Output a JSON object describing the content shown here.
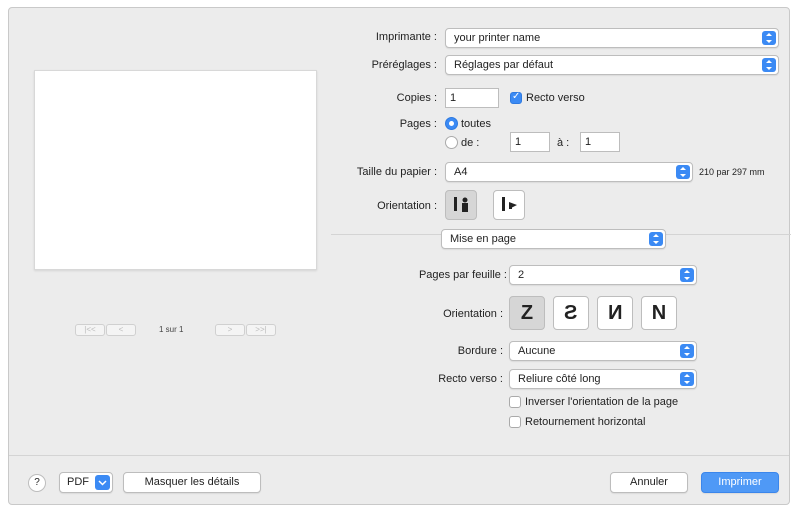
{
  "printer": {
    "label": "Imprimante :",
    "value": "your printer name"
  },
  "presets": {
    "label": "Préréglages :",
    "value": "Réglages par défaut"
  },
  "copies": {
    "label": "Copies :",
    "value": "1",
    "duplex_label": "Recto verso",
    "duplex_checked": true
  },
  "pages": {
    "label": "Pages :",
    "all_label": "toutes",
    "from_label": "de :",
    "from_value": "1",
    "to_label": "à :",
    "to_value": "1"
  },
  "paper": {
    "label": "Taille du papier :",
    "value": "A4",
    "dimensions": "210 par 297 mm"
  },
  "orientation": {
    "label": "Orientation :",
    "selected": "portrait"
  },
  "section": {
    "value": "Mise en page"
  },
  "layout": {
    "pages_per_sheet_label": "Pages par feuille :",
    "pages_per_sheet_value": "2",
    "orientation_label": "Orientation :",
    "orientation_glyphs": [
      "Z",
      "S",
      "N",
      "N"
    ],
    "border_label": "Bordure :",
    "border_value": "Aucune",
    "duplex_label": "Recto verso :",
    "duplex_value": "Reliure côté long",
    "reverse_label": "Inverser l'orientation de la page",
    "flip_label": "Retournement horizontal"
  },
  "preview": {
    "page_indicator": "1 sur 1",
    "first": "|<<",
    "prev": "<",
    "next": ">",
    "last": ">>|"
  },
  "footer": {
    "help": "?",
    "pdf": "PDF",
    "hide_details": "Masquer les détails",
    "cancel": "Annuler",
    "print": "Imprimer"
  },
  "colors": {
    "accent": "#3b8af4",
    "dialog_bg": "#ececec"
  }
}
